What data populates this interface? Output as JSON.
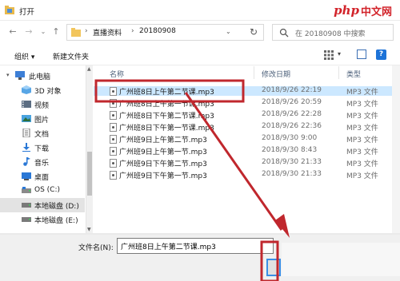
{
  "window": {
    "title": "打开"
  },
  "watermark": {
    "brand_latin": "php",
    "brand_cn": "中文网"
  },
  "nav": {
    "back": "←",
    "forward": "→",
    "recent": "⌄",
    "up": "↑",
    "breadcrumb": [
      "直播资料",
      "20180908"
    ],
    "search_placeholder": "在 20180908 中搜索"
  },
  "toolbar": {
    "organize": "组织 ▾",
    "new_folder": "新建文件夹"
  },
  "sidebar": {
    "items": [
      {
        "label": "此电脑",
        "icon": "computer-icon"
      },
      {
        "label": "3D 对象",
        "icon": "3d-objects-icon"
      },
      {
        "label": "视频",
        "icon": "video-icon"
      },
      {
        "label": "图片",
        "icon": "pictures-icon"
      },
      {
        "label": "文档",
        "icon": "documents-icon"
      },
      {
        "label": "下载",
        "icon": "download-icon"
      },
      {
        "label": "音乐",
        "icon": "music-icon"
      },
      {
        "label": "桌面",
        "icon": "desktop-icon"
      },
      {
        "label": "OS (C:)",
        "icon": "drive-icon"
      },
      {
        "label": "本地磁盘 (D:)",
        "icon": "drive-icon"
      },
      {
        "label": "本地磁盘 (E:)",
        "icon": "drive-icon"
      }
    ]
  },
  "columns": {
    "name": "名称",
    "date": "修改日期",
    "type": "类型"
  },
  "files": [
    {
      "name": "广州班8日上午第二节课.mp3",
      "date": "2018/9/26 22:19",
      "type": "MP3 文件"
    },
    {
      "name": "广州班8日上午第一节课.mp3",
      "date": "2018/9/26 20:59",
      "type": "MP3 文件"
    },
    {
      "name": "广州班8日下午第二节课.mp3",
      "date": "2018/9/26 22:28",
      "type": "MP3 文件"
    },
    {
      "name": "广州班8日下午第一节课.mp3",
      "date": "2018/9/26 22:36",
      "type": "MP3 文件"
    },
    {
      "name": "广州班9日上午第二节.mp3",
      "date": "2018/9/30 9:00",
      "type": "MP3 文件"
    },
    {
      "name": "广州班9日上午第一节.mp3",
      "date": "2018/9/30 8:43",
      "type": "MP3 文件"
    },
    {
      "name": "广州班9日下午第二节.mp3",
      "date": "2018/9/30 21:33",
      "type": "MP3 文件"
    },
    {
      "name": "广州班9日下午第一节.mp3",
      "date": "2018/9/30 21:33",
      "type": "MP3 文件"
    }
  ],
  "footer": {
    "filename_label": "文件名(N):",
    "filename_value": "广州班8日上午第二节课.mp3"
  },
  "colors": {
    "selection": "#cce8ff",
    "annotation": "#c0272d",
    "accent": "#1d73d8"
  }
}
